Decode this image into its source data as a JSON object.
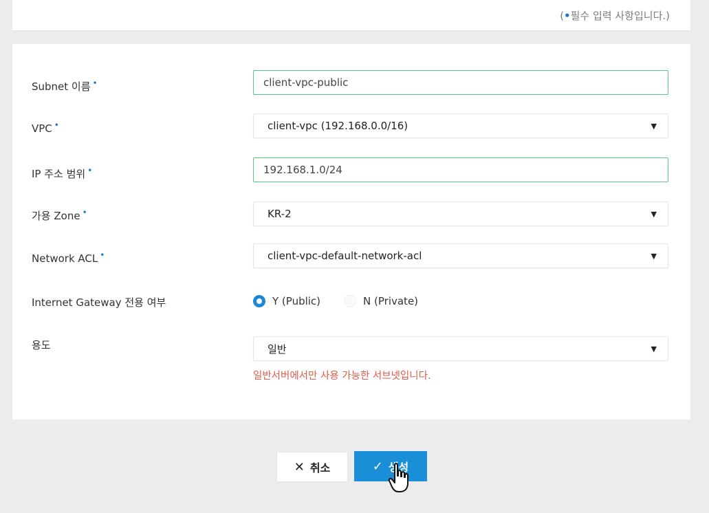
{
  "header": {
    "required_note_prefix": "(",
    "required_note_dot": "•",
    "required_note_text": "필수 입력 사항입니다.)"
  },
  "form": {
    "required_marker": "•",
    "subnet_name": {
      "label": "Subnet 이름",
      "value": "client-vpc-public"
    },
    "vpc": {
      "label": "VPC",
      "value": "client-vpc (192.168.0.0/16)"
    },
    "ip_range": {
      "label": "IP 주소 범위",
      "value": "192.168.1.0/24"
    },
    "zone": {
      "label": "가용 Zone",
      "value": "KR-2"
    },
    "network_acl": {
      "label": "Network ACL",
      "value": "client-vpc-default-network-acl"
    },
    "internet_gateway": {
      "label": "Internet Gateway 전용 여부",
      "options": [
        {
          "label": "Y (Public)",
          "selected": true
        },
        {
          "label": "N (Private)",
          "selected": false
        }
      ]
    },
    "usage": {
      "label": "용도",
      "value": "일반",
      "hint": "일반서버에서만 사용 가능한 서브넷입니다."
    }
  },
  "actions": {
    "cancel_label": "취소",
    "cancel_icon": "close-icon",
    "create_label": "생성",
    "create_icon": "check-icon"
  },
  "colors": {
    "accent": "#1b8ed8",
    "required_dot": "#1f74c9",
    "valid_border": "#56c97a",
    "hint_text": "#e25a4a"
  }
}
